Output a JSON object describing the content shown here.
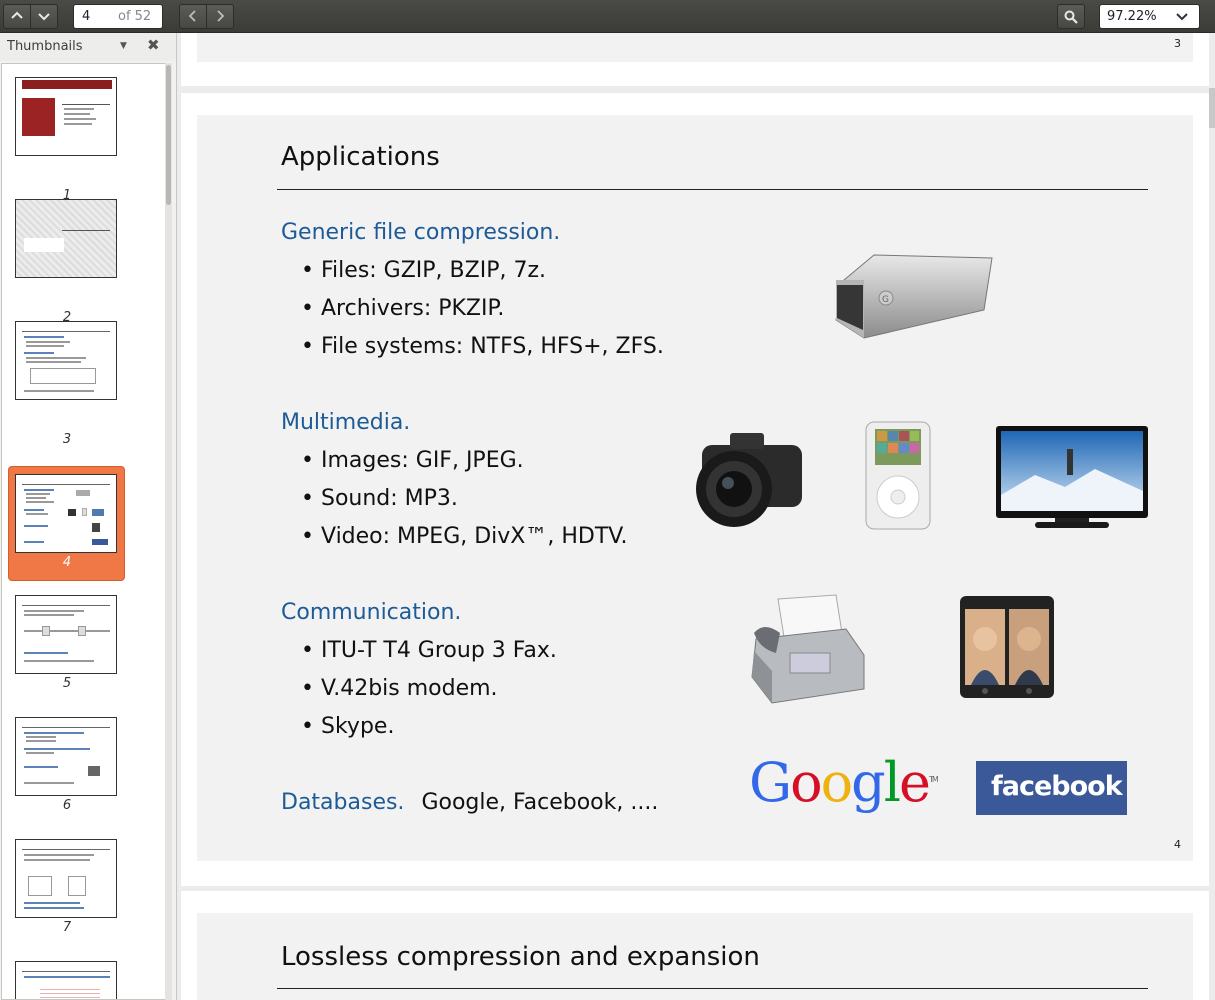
{
  "toolbar": {
    "prev_page": "▲",
    "next_page": "▼",
    "current_page": "4",
    "page_count": "of 52",
    "back": "‹",
    "forward": "›",
    "search_icon": "search-icon",
    "zoom": "97.22%"
  },
  "sidebar": {
    "title": "Thumbnails",
    "thumbnails": [
      {
        "num": "1"
      },
      {
        "num": "2"
      },
      {
        "num": "3"
      },
      {
        "num": "4"
      },
      {
        "num": "5"
      },
      {
        "num": "6"
      },
      {
        "num": "7"
      }
    ]
  },
  "pages": {
    "page3_number": "3",
    "page4_number": "4"
  },
  "slide4": {
    "title": "Applications",
    "sections": [
      {
        "heading": "Generic file compression.",
        "bullets": [
          "Files:  GZIP, BZIP, 7z.",
          "Archivers:  PKZIP.",
          "File systems:  NTFS, HFS+, ZFS."
        ]
      },
      {
        "heading": "Multimedia.",
        "bullets": [
          "Images:  GIF, JPEG.",
          "Sound:  MP3.",
          "Video:  MPEG, DivX™, HDTV."
        ]
      },
      {
        "heading": "Communication.",
        "bullets": [
          "ITU-T T4 Group 3 Fax.",
          "V.42bis modem.",
          "Skype."
        ]
      }
    ],
    "databases_heading": "Databases.",
    "databases_text": "Google, Facebook, ....",
    "google_logo": "Google",
    "facebook_logo": "facebook"
  },
  "slide5": {
    "title": "Lossless compression and expansion"
  }
}
